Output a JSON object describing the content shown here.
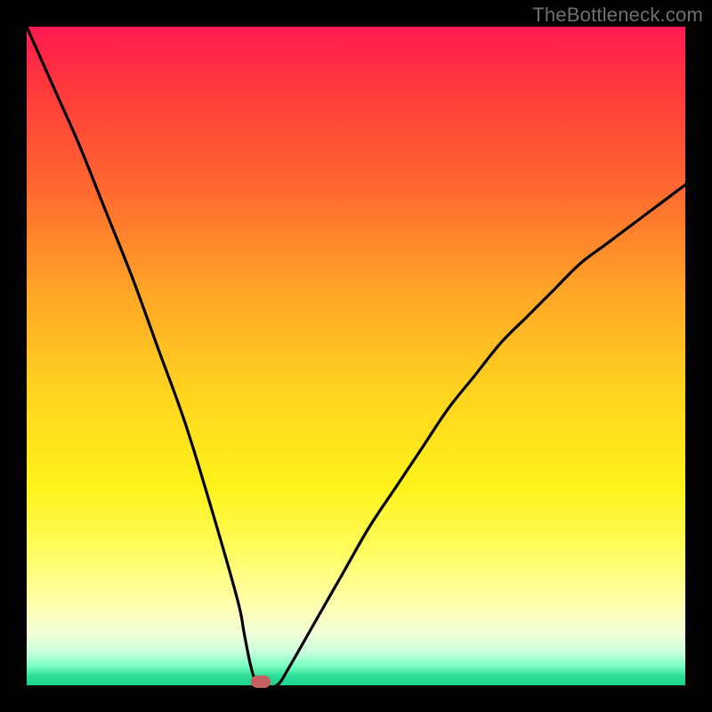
{
  "watermark": "TheBottleneck.com",
  "colors": {
    "frame": "#000000",
    "curve": "#000000",
    "marker": "#c76060"
  },
  "chart_data": {
    "type": "line",
    "title": "",
    "xlabel": "",
    "ylabel": "",
    "xlim": [
      0,
      100
    ],
    "ylim": [
      0,
      100
    ],
    "grid": false,
    "legend": false,
    "background_gradient": [
      "red",
      "orange",
      "yellow",
      "green"
    ],
    "x": [
      0,
      4,
      8,
      12,
      16,
      20,
      24,
      28,
      32,
      33,
      34,
      35,
      36,
      38,
      40,
      44,
      48,
      52,
      56,
      60,
      64,
      68,
      72,
      76,
      80,
      84,
      88,
      92,
      96,
      100
    ],
    "y": [
      100,
      91,
      82,
      72,
      62,
      51,
      40,
      27,
      13,
      8,
      3,
      0,
      0,
      0,
      3,
      10,
      17,
      24,
      30,
      36,
      42,
      47,
      52,
      56,
      60,
      64,
      67,
      70,
      73,
      76
    ],
    "notch_band": {
      "x_start": 33,
      "x_end": 38,
      "y": 0
    },
    "marker": {
      "x": 35.5,
      "y": 0
    }
  }
}
